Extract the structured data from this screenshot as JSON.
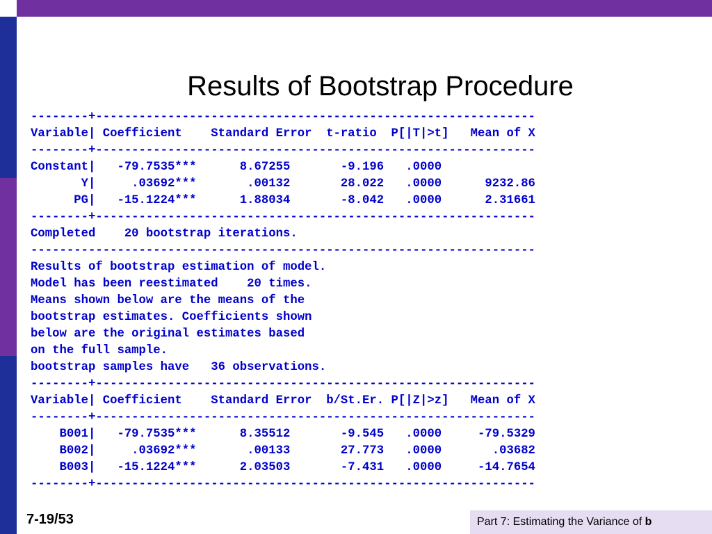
{
  "slide": {
    "title": "Results of Bootstrap Procedure",
    "page_number": "7-19/53",
    "footer_text": "Part 7: Estimating the Variance of ",
    "footer_bold": "b"
  },
  "colors": {
    "top_bar": "#7030A0",
    "sidebar": [
      "#ffffff",
      "#1F2F9A",
      "#7030A0",
      "#1F2F9A"
    ],
    "output_text": "#0000CC",
    "footer_box": "#E6DDF2"
  },
  "output": {
    "lines": [
      "--------+-------------------------------------------------------------",
      "Variable| Coefficient    Standard Error  t-ratio  P[|T|>t]   Mean of X",
      "--------+-------------------------------------------------------------",
      "Constant|   -79.7535***      8.67255       -9.196   .0000",
      "       Y|     .03692***       .00132       28.022   .0000      9232.86",
      "      PG|   -15.1224***      1.88034       -8.042   .0000      2.31661",
      "--------+-------------------------------------------------------------",
      "Completed    20 bootstrap iterations.",
      "----------------------------------------------------------------------",
      "Results of bootstrap estimation of model.",
      "Model has been reestimated    20 times.",
      "Means shown below are the means of the",
      "bootstrap estimates. Coefficients shown",
      "below are the original estimates based",
      "on the full sample.",
      "bootstrap samples have   36 observations.",
      "--------+-------------------------------------------------------------",
      "Variable| Coefficient    Standard Error  b/St.Er. P[|Z|>z]   Mean of X",
      "--------+-------------------------------------------------------------",
      "    B001|   -79.7535***      8.35512       -9.545   .0000     -79.5329",
      "    B002|     .03692***       .00133       27.773   .0000       .03682",
      "    B003|   -15.1224***      2.03503       -7.431   .0000     -14.7654",
      "--------+-------------------------------------------------------------"
    ]
  }
}
